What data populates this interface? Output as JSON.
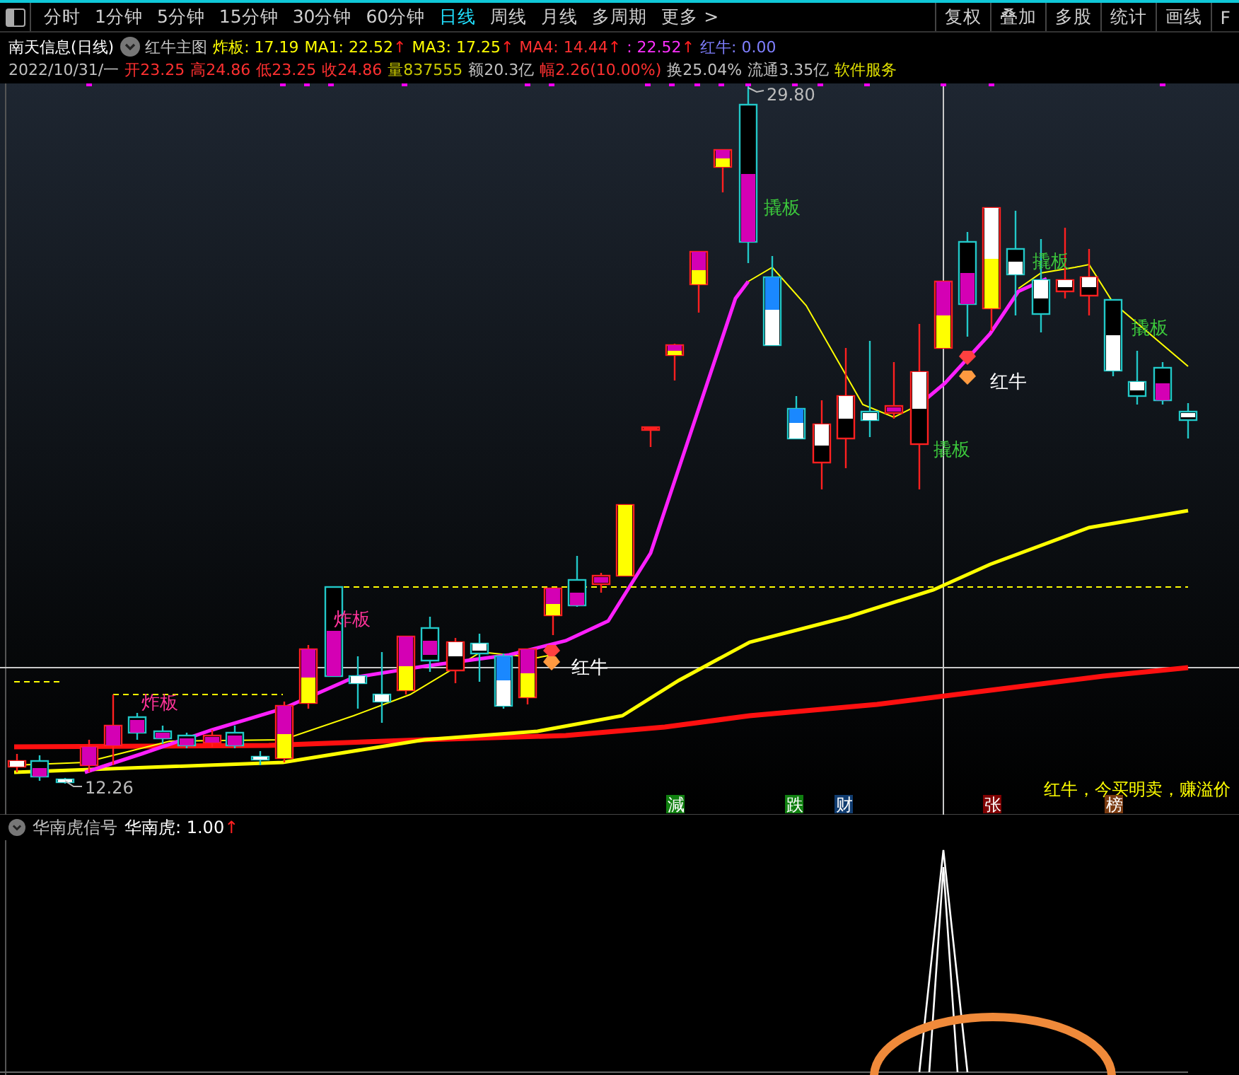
{
  "toolbar": {
    "periods": [
      {
        "label": "分时",
        "selected": false
      },
      {
        "label": "1分钟",
        "selected": false
      },
      {
        "label": "5分钟",
        "selected": false
      },
      {
        "label": "15分钟",
        "selected": false
      },
      {
        "label": "30分钟",
        "selected": false
      },
      {
        "label": "60分钟",
        "selected": false
      },
      {
        "label": "日线",
        "selected": true
      },
      {
        "label": "周线",
        "selected": false
      },
      {
        "label": "月线",
        "selected": false
      },
      {
        "label": "多周期",
        "selected": false
      },
      {
        "label": "更多 >",
        "selected": false
      }
    ],
    "actions": [
      "复权",
      "叠加",
      "多股",
      "统计",
      "画线",
      "F"
    ]
  },
  "header": {
    "title": "南天信息(日线)",
    "indicator": "红牛主图",
    "values": [
      {
        "text": "炸板: 17.19",
        "color": "#ffff00"
      },
      {
        "text": "MA1: 22.52",
        "color": "#ffff00",
        "arrow": "↑"
      },
      {
        "text": "MA3: 17.25",
        "color": "#ffff00",
        "arrow": "↑"
      },
      {
        "text": "MA4: 14.44",
        "color": "#ff3030",
        "arrow": "↑"
      },
      {
        "text": ": 22.52",
        "color": "#ff30ff",
        "arrow": "↑"
      },
      {
        "text": "红牛: 0.00",
        "color": "#7f7fff"
      }
    ]
  },
  "quote": [
    {
      "text": "2022/10/31/一",
      "color": "#c0c0c0"
    },
    {
      "text": "开23.25",
      "color": "#ff3030"
    },
    {
      "text": "高24.86",
      "color": "#ff3030"
    },
    {
      "text": "低23.25",
      "color": "#ff3030"
    },
    {
      "text": "收24.86",
      "color": "#ff3030"
    },
    {
      "text": "量837555",
      "color": "#c8c800"
    },
    {
      "text": "额20.3亿",
      "color": "#c0c0c0"
    },
    {
      "text": "幅2.26(10.00%)",
      "color": "#ff3030"
    },
    {
      "text": "换25.04%",
      "color": "#c0c0c0"
    },
    {
      "text": "流通3.35亿",
      "color": "#c0c0c0"
    },
    {
      "text": "软件服务",
      "color": "#e0e000"
    }
  ],
  "chart": {
    "high_label": "29.80",
    "low_label": "12.26",
    "signals": [
      {
        "text": "炸板",
        "kind": "break"
      },
      {
        "text": "炸板",
        "kind": "break"
      },
      {
        "text": "红牛",
        "kind": "bull"
      },
      {
        "text": "撬板",
        "kind": "pry"
      },
      {
        "text": "撬板",
        "kind": "pry"
      },
      {
        "text": "红牛",
        "kind": "bull"
      },
      {
        "text": "撬板",
        "kind": "pry"
      },
      {
        "text": "撬板",
        "kind": "pry"
      }
    ],
    "note": "红牛，今买明卖，赚溢价",
    "badges": [
      {
        "text": "減",
        "color": "#108010"
      },
      {
        "text": "跌",
        "color": "#108010"
      },
      {
        "text": "财",
        "color": "#103c70"
      },
      {
        "text": "张",
        "color": "#800000"
      },
      {
        "text": "榜",
        "color": "#7a3a10"
      }
    ]
  },
  "sub_panel": {
    "title": "华南虎信号",
    "value": "华南虎: 1.00",
    "arrow": "↑"
  }
}
